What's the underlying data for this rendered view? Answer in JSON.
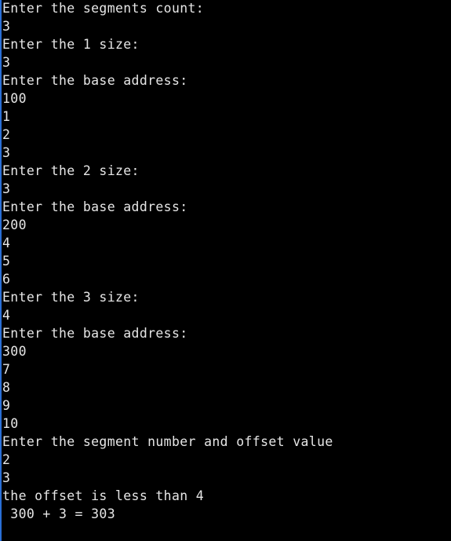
{
  "console": {
    "lines": [
      "Enter the segments count:",
      "3",
      "Enter the 1 size:",
      "3",
      "Enter the base address:",
      "100",
      "1",
      "2",
      "3",
      "Enter the 2 size:",
      "3",
      "Enter the base address:",
      "200",
      "4",
      "5",
      "6",
      "Enter the 3 size:",
      "4",
      "Enter the base address:",
      "300",
      "7",
      "8",
      "9",
      "10",
      "Enter the segment number and offset value",
      "2",
      "3",
      "the offset is less than 4",
      " 300 + 3 = 303"
    ]
  },
  "colors": {
    "background": "#000000",
    "text": "#e6e6e6",
    "left_edge": "#2a6fd6"
  }
}
